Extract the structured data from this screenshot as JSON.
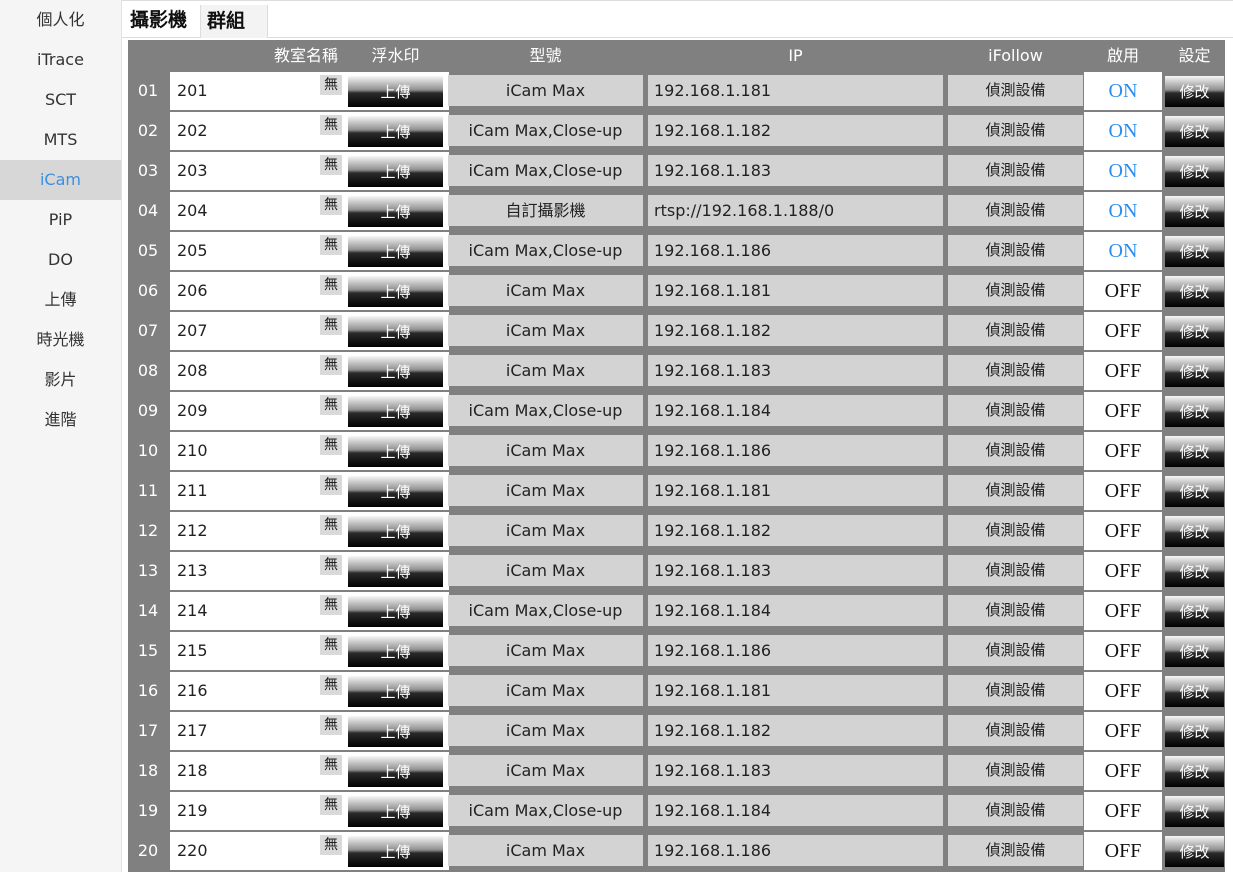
{
  "sidebar": {
    "items": [
      {
        "label": "個人化",
        "active": false
      },
      {
        "label": "iTrace",
        "active": false
      },
      {
        "label": "SCT",
        "active": false
      },
      {
        "label": "MTS",
        "active": false
      },
      {
        "label": "iCam",
        "active": true
      },
      {
        "label": "PiP",
        "active": false
      },
      {
        "label": "DO",
        "active": false
      },
      {
        "label": "上傳",
        "active": false
      },
      {
        "label": "時光機",
        "active": false
      },
      {
        "label": "影片",
        "active": false
      },
      {
        "label": "進階",
        "active": false
      }
    ]
  },
  "tabs": [
    {
      "label": "攝影機"
    },
    {
      "label": "群組"
    }
  ],
  "table": {
    "headers": {
      "name": "教室名稱",
      "watermark": "浮水印",
      "model": "型號",
      "ip": "IP",
      "ifollow": "iFollow",
      "enable": "啟用",
      "settings": "設定"
    },
    "labels": {
      "watermark_none": "無",
      "upload": "上傳",
      "detect": "偵測設備",
      "edit": "修改"
    },
    "colors": {
      "on": "#2b8ef0",
      "off": "#111111"
    },
    "rows": [
      {
        "no": "01",
        "name": "201",
        "model": "iCam Max",
        "ip": "192.168.1.181",
        "enabled": "ON"
      },
      {
        "no": "02",
        "name": "202",
        "model": "iCam Max,Close-up",
        "ip": "192.168.1.182",
        "enabled": "ON"
      },
      {
        "no": "03",
        "name": "203",
        "model": "iCam Max,Close-up",
        "ip": "192.168.1.183",
        "enabled": "ON"
      },
      {
        "no": "04",
        "name": "204",
        "model": "自訂攝影機",
        "ip": "rtsp://192.168.1.188/0",
        "enabled": "ON"
      },
      {
        "no": "05",
        "name": "205",
        "model": "iCam Max,Close-up",
        "ip": "192.168.1.186",
        "enabled": "ON"
      },
      {
        "no": "06",
        "name": "206",
        "model": "iCam Max",
        "ip": "192.168.1.181",
        "enabled": "OFF"
      },
      {
        "no": "07",
        "name": "207",
        "model": "iCam Max",
        "ip": "192.168.1.182",
        "enabled": "OFF"
      },
      {
        "no": "08",
        "name": "208",
        "model": "iCam Max",
        "ip": "192.168.1.183",
        "enabled": "OFF"
      },
      {
        "no": "09",
        "name": "209",
        "model": "iCam Max,Close-up",
        "ip": "192.168.1.184",
        "enabled": "OFF"
      },
      {
        "no": "10",
        "name": "210",
        "model": "iCam Max",
        "ip": "192.168.1.186",
        "enabled": "OFF"
      },
      {
        "no": "11",
        "name": "211",
        "model": "iCam Max",
        "ip": "192.168.1.181",
        "enabled": "OFF"
      },
      {
        "no": "12",
        "name": "212",
        "model": "iCam Max",
        "ip": "192.168.1.182",
        "enabled": "OFF"
      },
      {
        "no": "13",
        "name": "213",
        "model": "iCam Max",
        "ip": "192.168.1.183",
        "enabled": "OFF"
      },
      {
        "no": "14",
        "name": "214",
        "model": "iCam Max,Close-up",
        "ip": "192.168.1.184",
        "enabled": "OFF"
      },
      {
        "no": "15",
        "name": "215",
        "model": "iCam Max",
        "ip": "192.168.1.186",
        "enabled": "OFF"
      },
      {
        "no": "16",
        "name": "216",
        "model": "iCam Max",
        "ip": "192.168.1.181",
        "enabled": "OFF"
      },
      {
        "no": "17",
        "name": "217",
        "model": "iCam Max",
        "ip": "192.168.1.182",
        "enabled": "OFF"
      },
      {
        "no": "18",
        "name": "218",
        "model": "iCam Max",
        "ip": "192.168.1.183",
        "enabled": "OFF"
      },
      {
        "no": "19",
        "name": "219",
        "model": "iCam Max,Close-up",
        "ip": "192.168.1.184",
        "enabled": "OFF"
      },
      {
        "no": "20",
        "name": "220",
        "model": "iCam Max",
        "ip": "192.168.1.186",
        "enabled": "OFF"
      }
    ]
  }
}
